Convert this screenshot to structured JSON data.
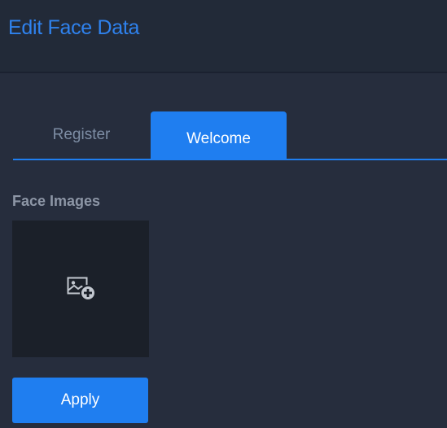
{
  "header": {
    "title": "Edit Face Data"
  },
  "tabs": [
    {
      "label": "Register",
      "active": false
    },
    {
      "label": "Welcome",
      "active": true
    }
  ],
  "face_images": {
    "label": "Face Images",
    "add_icon": "add-image-icon"
  },
  "actions": {
    "apply_label": "Apply"
  },
  "colors": {
    "accent": "#1f7ef0",
    "title": "#2f82ee",
    "background": "#262d3d",
    "slot": "#1b2029"
  }
}
